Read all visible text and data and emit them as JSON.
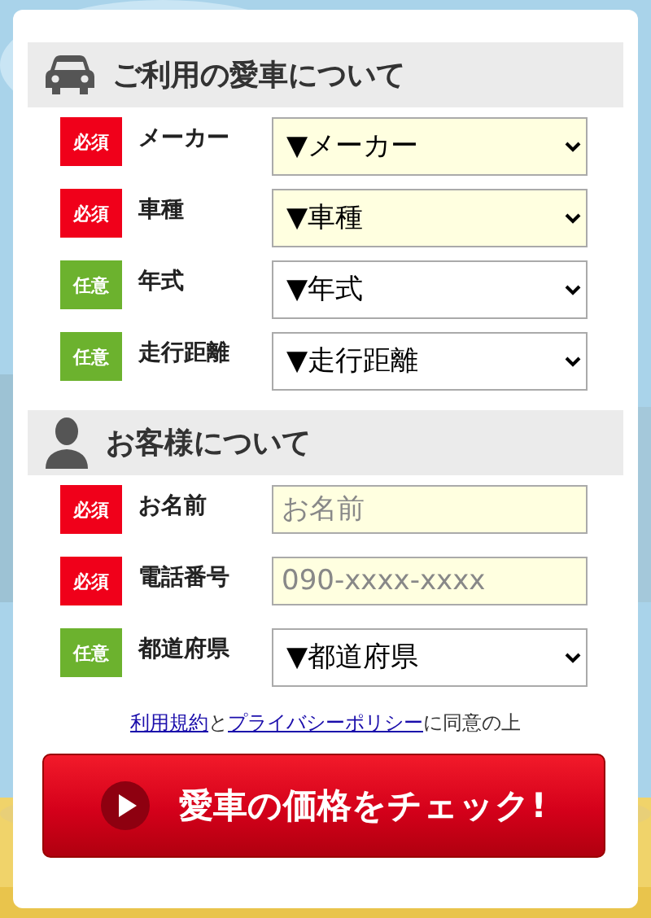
{
  "sections": [
    {
      "kind": "car",
      "title": "ご利用の愛車について",
      "fields": [
        {
          "kind": "select",
          "required": true,
          "badge": "必須",
          "label": "メーカー",
          "value": "▼メーカー"
        },
        {
          "kind": "select",
          "required": true,
          "badge": "必須",
          "label": "車種",
          "value": "▼車種"
        },
        {
          "kind": "select",
          "required": false,
          "badge": "任意",
          "label": "年式",
          "value": "▼年式"
        },
        {
          "kind": "select",
          "required": false,
          "badge": "任意",
          "label": "走行距離",
          "value": "▼走行距離"
        }
      ]
    },
    {
      "kind": "person",
      "title": "お客様について",
      "fields": [
        {
          "kind": "input",
          "required": true,
          "badge": "必須",
          "label": "お名前",
          "placeholder": "お名前"
        },
        {
          "kind": "input",
          "required": true,
          "badge": "必須",
          "label": "電話番号",
          "placeholder": "090-xxxx-xxxx"
        },
        {
          "kind": "select",
          "required": false,
          "badge": "任意",
          "label": "都道府県",
          "value": "▼都道府県"
        }
      ]
    }
  ],
  "agreement": {
    "link_1": "利用規約",
    "text_1": "と",
    "link_2": "プライバシーポリシー",
    "text_2": "に同意の上"
  },
  "submit_button": "愛車の価格をチェック!"
}
